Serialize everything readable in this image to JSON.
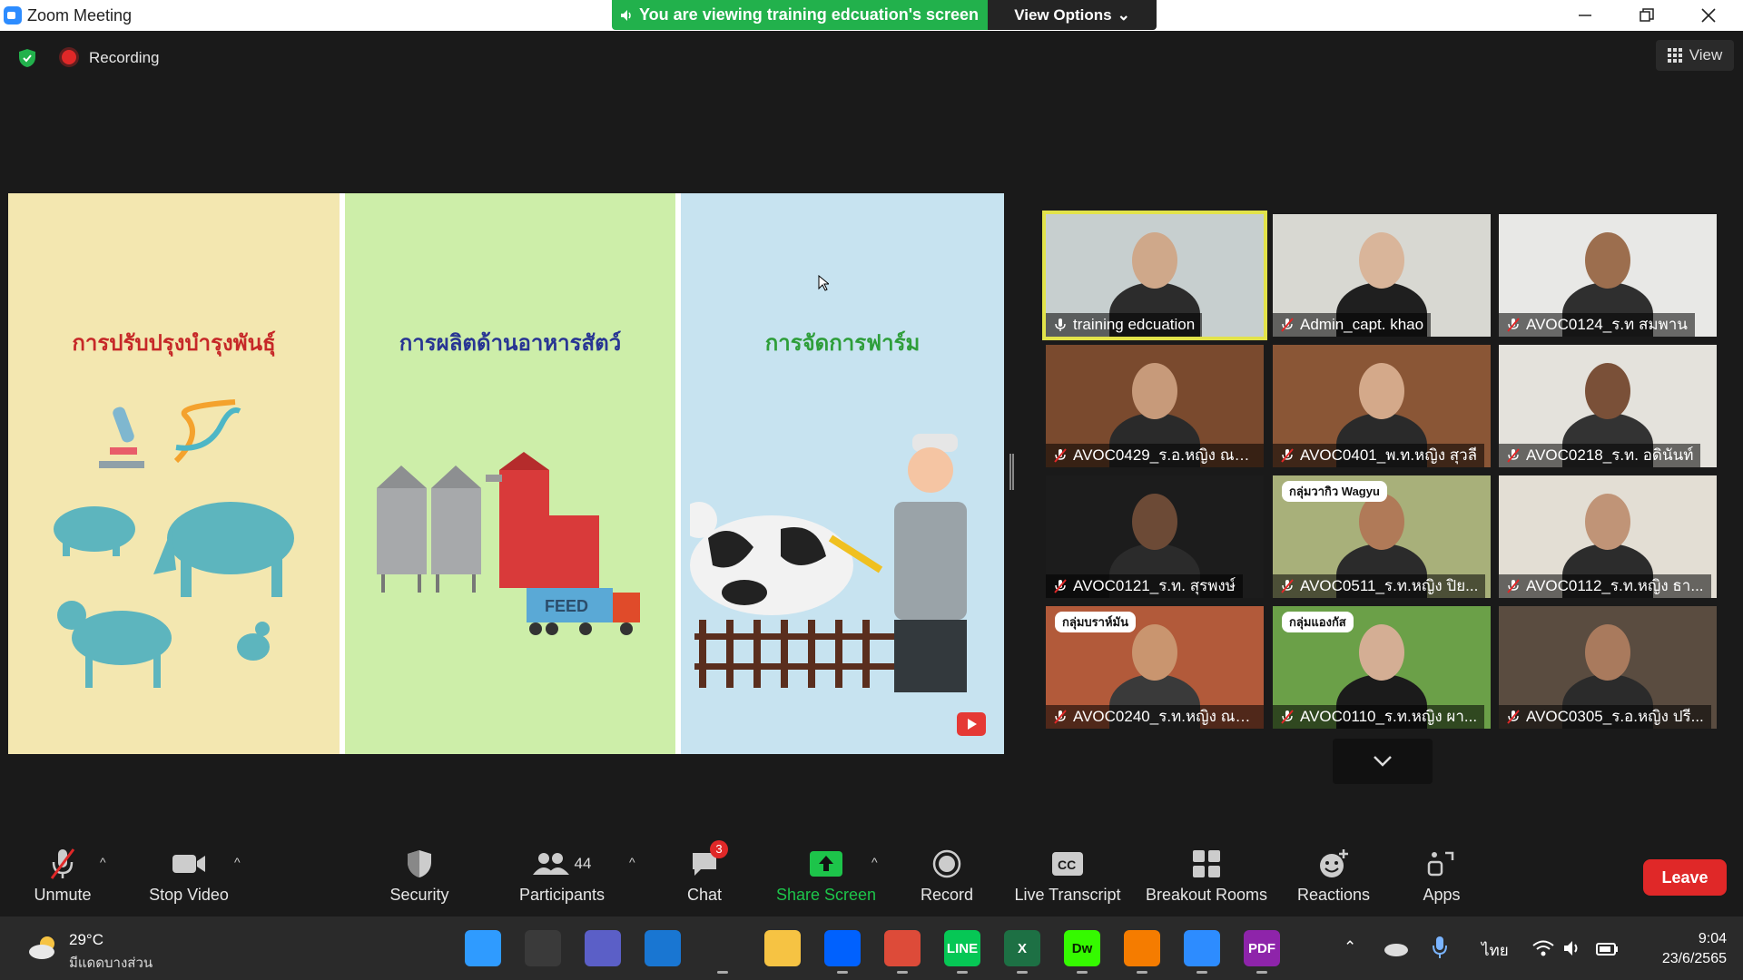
{
  "window": {
    "title": "Zoom Meeting",
    "minimize_icon": "minimize-icon",
    "restore_icon": "restore-icon",
    "close_icon": "close-icon"
  },
  "banner": {
    "viewing_text": "You are viewing training edcuation's screen",
    "view_options_label": "View Options"
  },
  "status": {
    "recording_label": "Recording",
    "view_label": "View"
  },
  "shared_screen": {
    "panels": [
      {
        "title": "การปรับปรุงบำรุงพันธุ์",
        "bg": "#f3e7b0",
        "title_color": "#c62828"
      },
      {
        "title": "การผลิตด้านอาหารสัตว์",
        "bg": "#cdeea9",
        "title_color": "#283593"
      },
      {
        "title": "การจัดการฟาร์ม",
        "bg": "#c7e3f0",
        "title_color": "#2e9e3a"
      }
    ],
    "feed_label": "FEED"
  },
  "gallery": {
    "participants": [
      {
        "name": "training edcuation",
        "active": true,
        "muted": false
      },
      {
        "name": "Admin_capt. khao",
        "active": false,
        "muted": true
      },
      {
        "name": "AVOC0124_ร.ท สมพาน",
        "active": false,
        "muted": true
      },
      {
        "name": "AVOC0429_ร.อ.หญิง ณป...",
        "active": false,
        "muted": true
      },
      {
        "name": "AVOC0401_พ.ท.หญิง สุวลี",
        "active": false,
        "muted": true
      },
      {
        "name": "AVOC0218_ร.ท. อดินันท์",
        "active": false,
        "muted": true
      },
      {
        "name": "AVOC0121_ร.ท. สุรพงษ์",
        "active": false,
        "muted": true
      },
      {
        "name": "AVOC0511_ร.ท.หญิง ปิย...",
        "active": false,
        "muted": true
      },
      {
        "name": "AVOC0112_ร.ท.หญิง ธา...",
        "active": false,
        "muted": true
      },
      {
        "name": "AVOC0240_ร.ท.หญิง ณก...",
        "active": false,
        "muted": true
      },
      {
        "name": "AVOC0110_ร.ท.หญิง ผา...",
        "active": false,
        "muted": true
      },
      {
        "name": "AVOC0305_ร.อ.หญิง ปรี...",
        "active": false,
        "muted": true
      }
    ],
    "tile_captions": {
      "wagyu": "กลุ่มวากิว Wagyu",
      "brahman": "กลุ่มบราห์มัน",
      "angus": "กลุ่มแองกัส"
    }
  },
  "toolbar": {
    "unmute": "Unmute",
    "stop_video": "Stop Video",
    "security": "Security",
    "participants": "Participants",
    "participants_count": "44",
    "chat": "Chat",
    "chat_badge": "3",
    "share_screen": "Share Screen",
    "record": "Record",
    "live_transcript": "Live Transcript",
    "breakout_rooms": "Breakout Rooms",
    "reactions": "Reactions",
    "apps": "Apps",
    "leave": "Leave",
    "cc_text": "CC"
  },
  "taskbar": {
    "temperature": "29°C",
    "weather": "มีแดดบางส่วน",
    "language": "ไทย",
    "time": "9:04",
    "date": "23/6/2565",
    "apps": [
      {
        "name": "start-icon",
        "color": "#2f9bff",
        "label": ""
      },
      {
        "name": "task-view-icon",
        "color": "#3a3a3a",
        "label": ""
      },
      {
        "name": "teams-chat-icon",
        "color": "#5b5fc7",
        "label": ""
      },
      {
        "name": "mail-icon",
        "color": "#1976d2",
        "label": ""
      },
      {
        "name": "app-s-icon",
        "color": "#2a2a2a",
        "label": ""
      },
      {
        "name": "file-explorer-icon",
        "color": "#f6c343",
        "label": ""
      },
      {
        "name": "dropbox-icon",
        "color": "#0061fe",
        "label": ""
      },
      {
        "name": "chrome-icon",
        "color": "#dd4b39",
        "label": ""
      },
      {
        "name": "line-icon",
        "color": "#06c755",
        "label": "LINE"
      },
      {
        "name": "excel-icon",
        "color": "#1d7044",
        "label": "X"
      },
      {
        "name": "dreamweaver-icon",
        "color": "#35fa00",
        "label": "Dw"
      },
      {
        "name": "media-player-icon",
        "color": "#f57c00",
        "label": ""
      },
      {
        "name": "zoom-icon",
        "color": "#2d8cff",
        "label": ""
      },
      {
        "name": "pdf-icon",
        "color": "#8e24aa",
        "label": "PDF"
      }
    ]
  },
  "colors": {
    "accent_green": "#22b14c",
    "leave_red": "#e02828",
    "active_speaker": "#e2e34a"
  }
}
